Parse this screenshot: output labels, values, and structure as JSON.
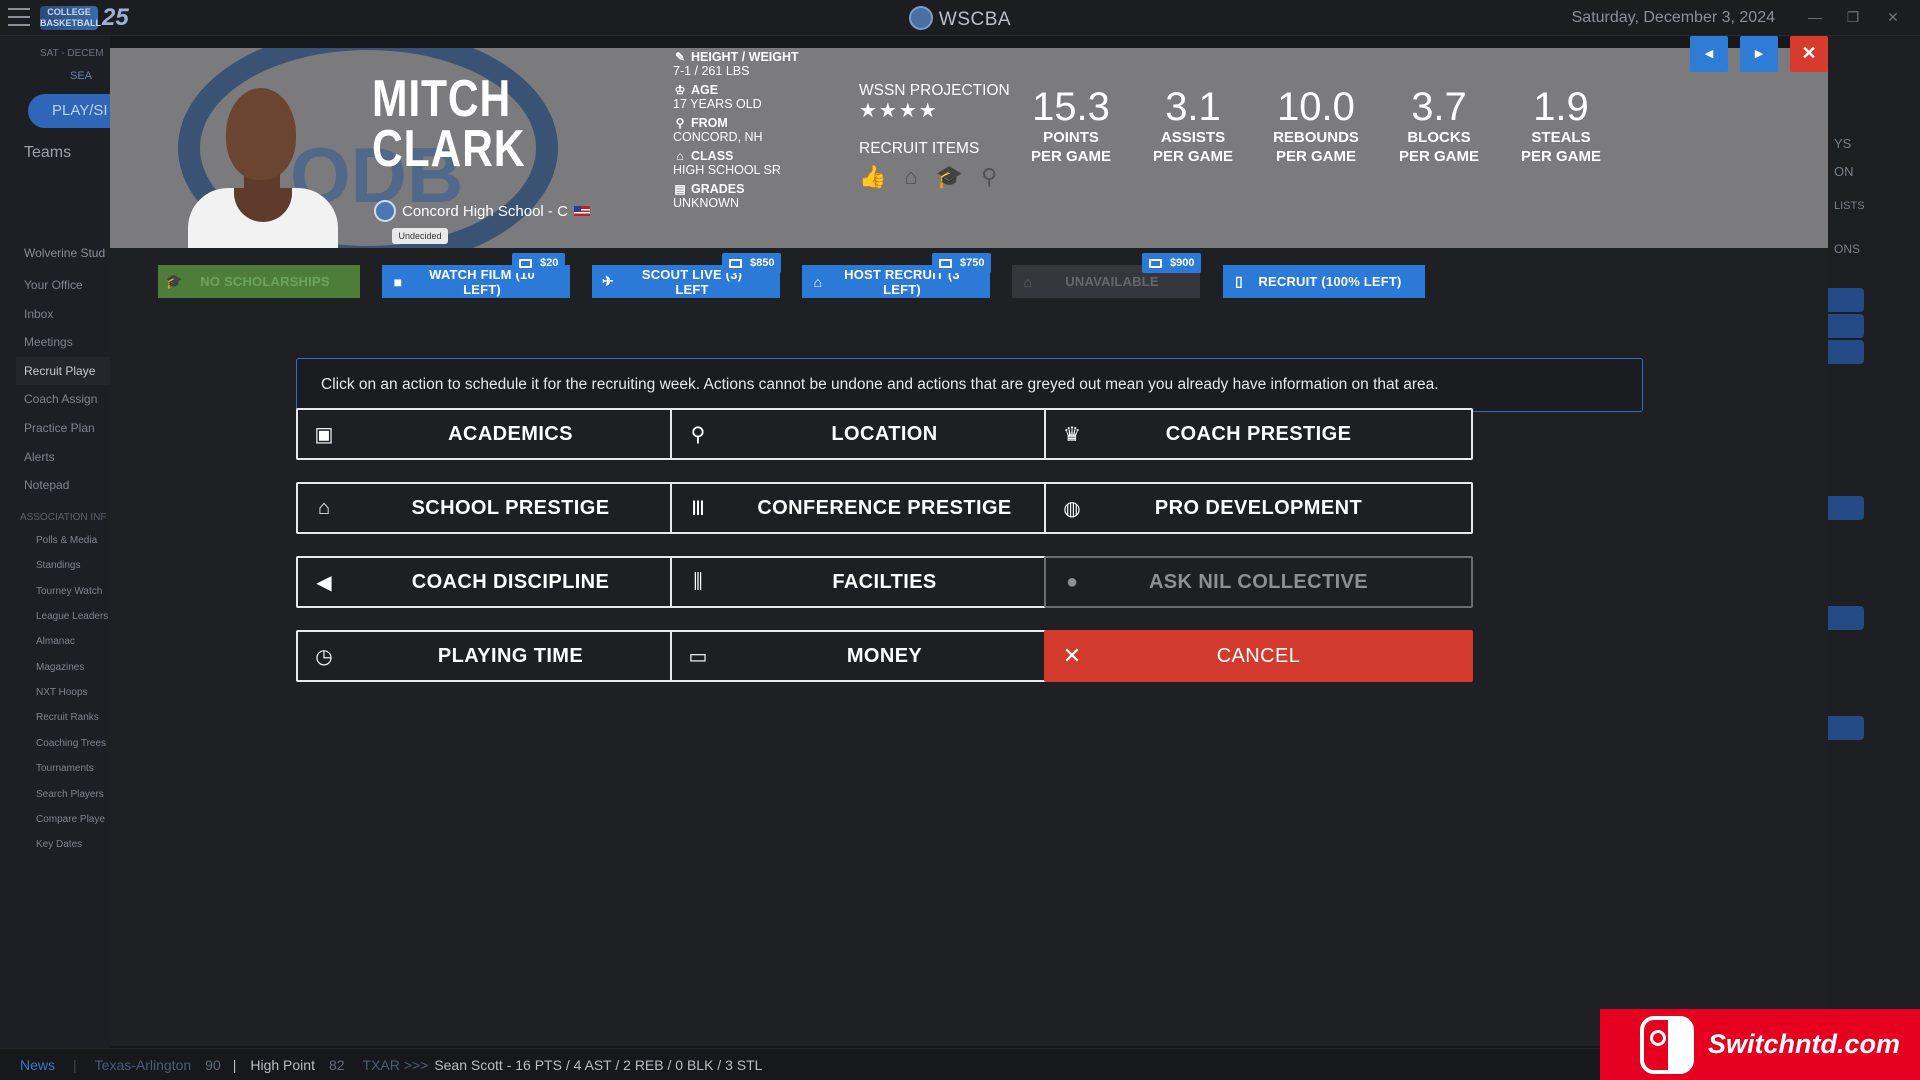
{
  "window": {
    "logo_text": "COLLEGE BASKETBALL",
    "logo_number": "25",
    "title": "WSCBA",
    "date": "Saturday, December 3, 2024"
  },
  "sidebar": {
    "top_label": "SAT - DECEM",
    "search_label": "SEA",
    "play_label": "PLAY/SI",
    "teams_label": "Teams",
    "team_name": "Wolverine Stud",
    "items": [
      {
        "label": "Your Office"
      },
      {
        "label": "Inbox"
      },
      {
        "label": "Meetings"
      },
      {
        "label": "Recruit Playe"
      },
      {
        "label": "Coach Assign"
      },
      {
        "label": "Practice Plan"
      },
      {
        "label": "Alerts"
      },
      {
        "label": "Notepad"
      }
    ],
    "assoc_header": "ASSOCIATION INF",
    "assoc_items": [
      {
        "label": "Polls & Media"
      },
      {
        "label": "Standings"
      },
      {
        "label": "Tourney Watch"
      },
      {
        "label": "League Leaders"
      },
      {
        "label": "Almanac"
      },
      {
        "label": "Magazines"
      },
      {
        "label": "NXT Hoops"
      },
      {
        "label": "Recruit Ranks"
      },
      {
        "label": "Coaching Trees"
      },
      {
        "label": "Tournaments"
      },
      {
        "label": "Search Players"
      },
      {
        "label": "Compare Playe"
      },
      {
        "label": "Key Dates"
      }
    ]
  },
  "background_right": {
    "labels": [
      "YS",
      "ON",
      "LISTS",
      "ONS"
    ]
  },
  "player": {
    "first_name": "MITCH",
    "last_name": "CLARK",
    "school": "Concord High School - C",
    "status": "Undecided",
    "bio": [
      {
        "label": "HEIGHT / WEIGHT",
        "value": "7-1 / 261 LBS",
        "icon": "ruler-icon"
      },
      {
        "label": "AGE",
        "value": "17 YEARS OLD",
        "icon": "age-icon"
      },
      {
        "label": "FROM",
        "value": "CONCORD, NH",
        "icon": "map-pin-icon"
      },
      {
        "label": "CLASS",
        "value": "HIGH SCHOOL SR",
        "icon": "school-icon"
      },
      {
        "label": "GRADES",
        "value": "UNKNOWN",
        "icon": "grades-icon"
      }
    ],
    "projection_title": "WSSN PROJECTION",
    "stars": "★★★★",
    "star_rating": 4,
    "recruit_items_title": "RECRUIT ITEMS",
    "recruit_items_icons": [
      "thumbs-up-icon",
      "school-icon",
      "graduation-cap-icon",
      "location-person-icon"
    ],
    "stats": [
      {
        "value": "15.3",
        "label": "POINTS\nPER GAME"
      },
      {
        "value": "3.1",
        "label": "ASSISTS\nPER GAME"
      },
      {
        "value": "10.0",
        "label": "REBOUNDS\nPER GAME"
      },
      {
        "value": "3.7",
        "label": "BLOCKS\nPER GAME"
      },
      {
        "value": "1.9",
        "label": "STEALS\nPER GAME"
      }
    ]
  },
  "actions": [
    {
      "label": "NO SCHOLARSHIPS",
      "state": "green",
      "icon": "graduation-cap-icon"
    },
    {
      "label": "WATCH FILM (10 LEFT)",
      "state": "blue",
      "icon": "video-icon",
      "price": "$20"
    },
    {
      "label": "SCOUT LIVE (3) LEFT",
      "state": "blue",
      "icon": "plane-icon",
      "price": "$850"
    },
    {
      "label": "HOST RECRUIT (3 LEFT)",
      "state": "blue",
      "icon": "school-icon",
      "price": "$750"
    },
    {
      "label": "UNAVAILABLE",
      "state": "gray",
      "icon": "home-icon",
      "price": "$900"
    },
    {
      "label": "RECRUIT (100% LEFT)",
      "state": "blue",
      "icon": "phone-icon"
    }
  ],
  "info_text": "Click on an action to schedule it for the recruiting week. Actions cannot be undone and actions that are greyed out mean you already have information on that area.",
  "options": [
    {
      "label": "ACADEMICS",
      "icon": "academics-icon",
      "glyph": "▣"
    },
    {
      "label": "LOCATION",
      "icon": "map-pin-icon",
      "glyph": "⚲"
    },
    {
      "label": "COACH PRESTIGE",
      "icon": "crown-icon",
      "glyph": "♛"
    },
    {
      "label": "SCHOOL PRESTIGE",
      "icon": "school-icon",
      "glyph": "⌂"
    },
    {
      "label": "CONFERENCE PRESTIGE",
      "icon": "columns-icon",
      "glyph": "Ⅲ"
    },
    {
      "label": "PRO DEVELOPMENT",
      "icon": "basketball-icon",
      "glyph": "◍"
    },
    {
      "label": "COACH DISCIPLINE",
      "icon": "megaphone-icon",
      "glyph": "◀"
    },
    {
      "label": "FACILTIES",
      "icon": "dumbbell-icon",
      "glyph": "⫼"
    },
    {
      "label": "ASK NIL COLLECTIVE",
      "icon": "piggy-bank-icon",
      "glyph": "●",
      "disabled": true
    },
    {
      "label": "PLAYING TIME",
      "icon": "stopwatch-icon",
      "glyph": "◷"
    },
    {
      "label": "MONEY",
      "icon": "money-icon",
      "glyph": "▭"
    },
    {
      "label": "CANCEL",
      "icon": "close-icon",
      "glyph": "✕",
      "cancel": true
    }
  ],
  "nav": {
    "prev": "◀",
    "next": "▶",
    "close": "✕"
  },
  "ticker": {
    "news_label": "News",
    "team1": "Texas-Arlington",
    "score1": "90",
    "team2": "High Point",
    "score2": "82",
    "prefix": "TXAR >>>",
    "headline": "Sean Scott - 16 PTS / 4 AST / 2 REB / 0 BLK / 3 STL"
  },
  "watermark": {
    "text": "Switchntd.com"
  },
  "colors": {
    "accent_blue": "#2b7ad8",
    "cancel_red": "#d23a2d",
    "green": "#4e7d3a",
    "header_gray": "#7b7b7d"
  }
}
